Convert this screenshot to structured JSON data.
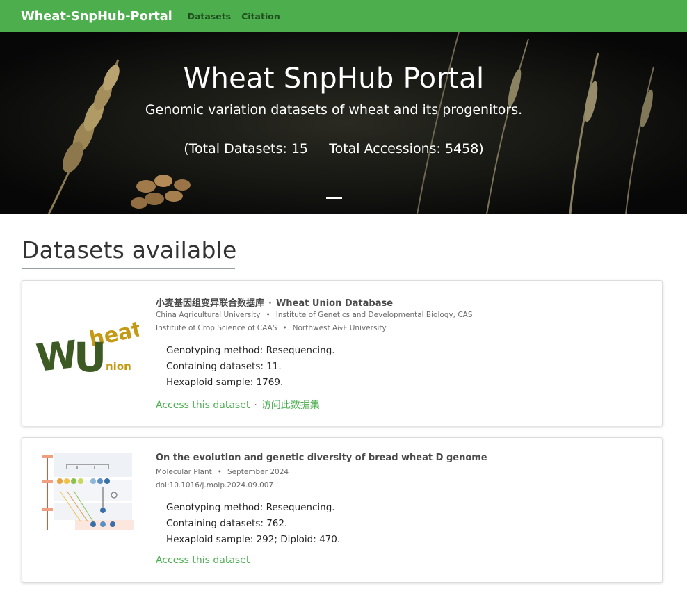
{
  "nav": {
    "brand": "Wheat-SnpHub-Portal",
    "links": [
      "Datasets",
      "Citation"
    ]
  },
  "hero": {
    "title": "Wheat SnpHub Portal",
    "subtitle": "Genomic variation datasets of wheat and its progenitors.",
    "stats": "(Total Datasets: 15     Total Accessions: 5458)"
  },
  "section": {
    "title": "Datasets available"
  },
  "datasets": [
    {
      "title_cn": "小麦基因组变异联合数据库",
      "title_sep": "·",
      "title_en": "Wheat Union Database",
      "meta_line1": [
        "China Agricultural University",
        "Institute of Genetics and Developmental Biology, CAS"
      ],
      "meta_line2": [
        "Institute of Crop Science of CAAS",
        "Northwest A&F University"
      ],
      "details": [
        "Genotyping method: Resequencing.",
        "Containing datasets: 11.",
        "Hexaploid sample: 1769."
      ],
      "link_en": "Access this dataset",
      "link_sep": "·",
      "link_cn": "访问此数据集",
      "logo": {
        "letters_w": "W",
        "letters_heat": "heat",
        "letters_u": "U",
        "letters_nion": "nion",
        "color_dark": "#3e5a24",
        "color_gold": "#c49a14"
      }
    },
    {
      "title": "On the evolution and genetic diversity of bread wheat D genome",
      "meta_line1": [
        "Molecular Plant",
        "September 2024"
      ],
      "meta_line2": [
        "doi:10.1016/j.molp.2024.09.007"
      ],
      "details": [
        "Genotyping method: Resequencing.",
        "Containing datasets: 762.",
        "Hexaploid sample: 292; Diploid: 470."
      ],
      "link_en": "Access this dataset"
    }
  ],
  "colors": {
    "navbar": "#4cae4c",
    "link": "#4caf50"
  }
}
